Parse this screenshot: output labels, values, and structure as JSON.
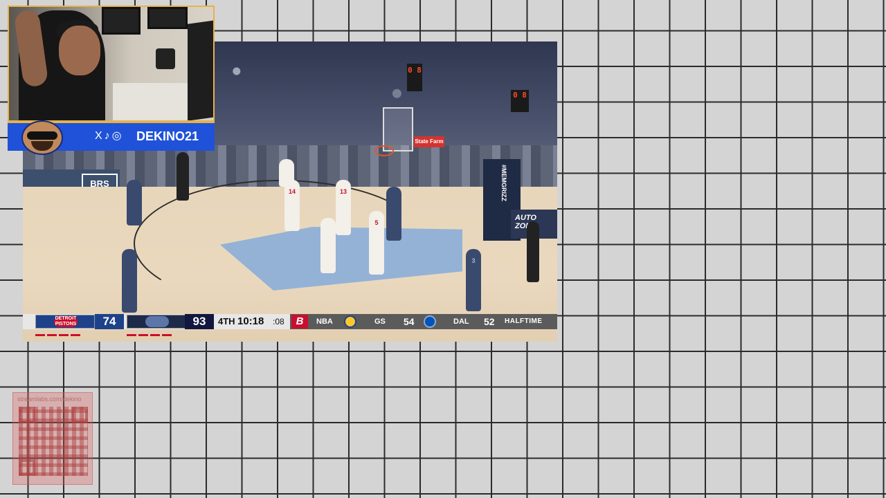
{
  "scoreboard": {
    "home_team_logo": "DETROIT PISTONS",
    "home_score": "74",
    "away_score": "93",
    "period": "4TH",
    "game_clock": "10:18",
    "shot_clock": ":08",
    "ticker": {
      "sponsor_logo": "B",
      "league": "NBA",
      "team1": "GS",
      "team1_score": "54",
      "team2": "DAL",
      "team2_score": "52",
      "status": "HALFTIME"
    }
  },
  "arena": {
    "board_brs": "BRS",
    "state_farm": "State Farm",
    "stanchion_text": "#MEMGRIZZ",
    "side_board": "AUTO ZONE",
    "shot_clock_display": "0 8"
  },
  "players": [
    "14",
    "13",
    "5",
    "3"
  ],
  "streamer": {
    "social_icons": "X♪◎",
    "handle": "DEKINO21"
  },
  "qr_overlay": {
    "url": "streamlabs.com/dekino"
  },
  "colors": {
    "pistons_blue": "#1d428a",
    "pistons_red": "#c8102e",
    "grizzlies_navy": "#12173f",
    "banner_blue": "#1f52d8",
    "webcam_border": "#e7b24a"
  }
}
